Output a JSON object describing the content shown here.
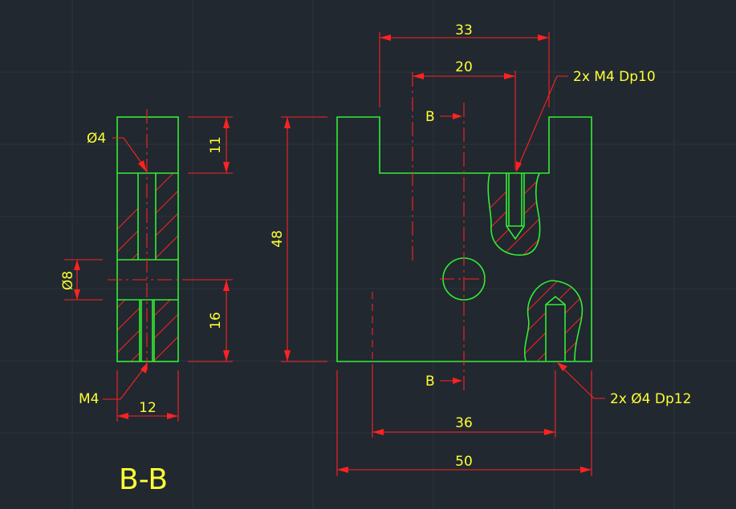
{
  "drawing": {
    "colors": {
      "background": "#212830",
      "outline": "#33ee33",
      "dimension": "#ff2222",
      "text": "#ffff33"
    },
    "section_view": {
      "title": "B-B",
      "dim_top_height": "11",
      "dim_bottom_height": "16",
      "dim_width": "12",
      "label_hole_top": "Ø4",
      "label_hole_cross": "Ø8",
      "label_thread_bottom": "M4"
    },
    "main_view": {
      "dim_top_slot": "33",
      "dim_inner_slot": "20",
      "dim_height": "48",
      "dim_holes_spacing": "36",
      "dim_overall_width": "50",
      "note_threads": "2x M4 Dp10",
      "note_holes": "2x Ø4 Dp12",
      "section_mark_top": "B",
      "section_mark_bottom": "B"
    }
  }
}
